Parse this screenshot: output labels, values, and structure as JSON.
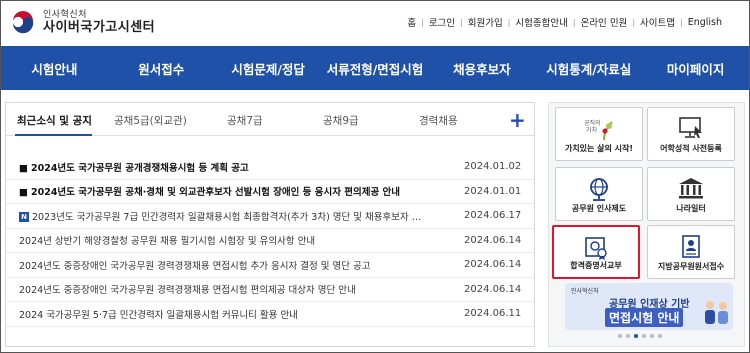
{
  "header": {
    "logo_sub": "인사혁신처",
    "logo_main": "사이버국가고시센터",
    "util_links": [
      "홈",
      "로그인",
      "회원가입",
      "시험종합안내",
      "온라인 민원",
      "사이트맵",
      "English"
    ]
  },
  "nav": {
    "items": [
      "시험안내",
      "원서접수",
      "시험문제/정답",
      "서류전형/면접시험",
      "채용후보자",
      "시험통계/자료실",
      "마이페이지"
    ]
  },
  "tabs": {
    "items": [
      "최근소식 및 공지",
      "공채5급(외교관)",
      "공채7급",
      "공채9급",
      "경력채용"
    ],
    "active": "최근소식 및 공지",
    "plus": "+"
  },
  "news": [
    {
      "prefix": "■",
      "title": "2024년도 국가공무원 공개경쟁채용시험 등 계획 공고",
      "date": "2024.01.02",
      "bold": true
    },
    {
      "prefix": "■",
      "title": "2024년도 국가공무원 공채·경채 및 외교관후보자 선발시험 장애인 등 응시자 편의제공 안내",
      "date": "2024.01.01",
      "bold": true
    },
    {
      "prefix": "N",
      "title": "2023년도 국가공무원 7급 민간경력자 일괄채용시험 최종합격자(추가 3차) 명단 및 채용후보자 …",
      "date": "2024.06.17",
      "bold": false
    },
    {
      "prefix": "",
      "title": "2024년 상반기 해양경찰청 공무원 채용 필기시험 시험장 및 유의사항 안내",
      "date": "2024.06.14",
      "bold": false
    },
    {
      "prefix": "",
      "title": "2024년도 중증장애인 국가공무원 경력경쟁채용 면접시험 추가 응시자 결정 및 명단 공고",
      "date": "2024.06.14",
      "bold": false
    },
    {
      "prefix": "",
      "title": "2024년도 중증장애인 국가공무원 경력경쟁채용 면접시험 편의제공 대상자 명단 안내",
      "date": "2024.06.14",
      "bold": false
    },
    {
      "prefix": "",
      "title": "2024 국가공무원 5·7급 민간경력자 일괄채용시험 커뮤니티 활용 안내",
      "date": "2024.06.11",
      "bold": false
    }
  ],
  "quick": {
    "items": [
      {
        "label": "가치있는 삶의 시작!",
        "icon": "value-life-icon"
      },
      {
        "label": "어학성적 사전등록",
        "icon": "monitor-pointer-icon"
      },
      {
        "label": "공무원 인사제도",
        "icon": "globe-stand-icon"
      },
      {
        "label": "나라일터",
        "icon": "government-building-icon"
      },
      {
        "label": "합격증명서교부",
        "icon": "certificate-icon"
      },
      {
        "label": "지방공무원원서접수",
        "icon": "application-form-icon"
      }
    ],
    "highlighted": "합격증명서교부"
  },
  "banner": {
    "small": "인사혁신처",
    "line1": "공무원 인재상 기반",
    "line2": "면접시험 안내"
  },
  "colors": {
    "nav_bg": "#1f51a8",
    "highlight": "#e0142b"
  }
}
